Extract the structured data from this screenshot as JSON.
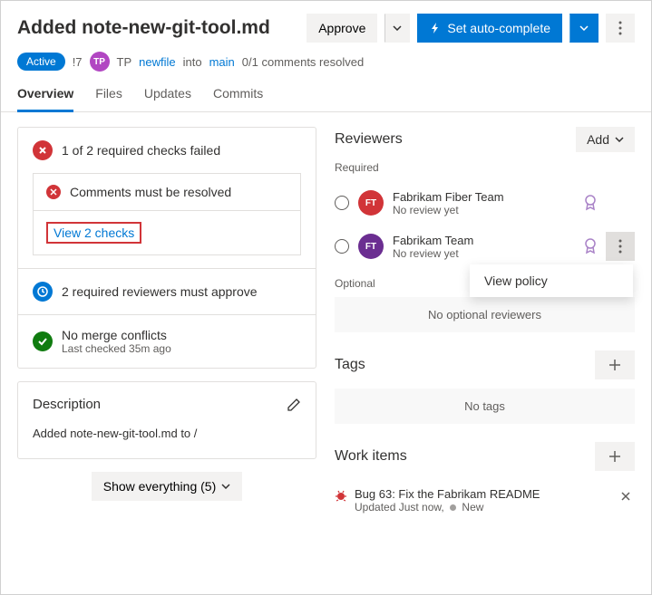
{
  "header": {
    "title": "Added note-new-git-tool.md",
    "approve": "Approve",
    "autocomplete": "Set auto-complete"
  },
  "meta": {
    "status": "Active",
    "pr_id": "!7",
    "avatar_initials": "TP",
    "author": "TP",
    "source_branch": "newfile",
    "into": "into",
    "target_branch": "main",
    "comments": "0/1 comments resolved"
  },
  "tabs": {
    "overview": "Overview",
    "files": "Files",
    "updates": "Updates",
    "commits": "Commits"
  },
  "checks": {
    "failed_title": "1 of 2 required checks failed",
    "comments_resolved": "Comments must be resolved",
    "view_link": "View 2 checks",
    "reviewers_approve": "2 required reviewers must approve",
    "no_conflicts": "No merge conflicts",
    "last_checked": "Last checked 35m ago"
  },
  "description": {
    "title": "Description",
    "body": "Added note-new-git-tool.md to /"
  },
  "show_everything": "Show everything (5)",
  "reviewers": {
    "title": "Reviewers",
    "add": "Add",
    "required": "Required",
    "optional": "Optional",
    "no_optional": "No optional reviewers",
    "items": [
      {
        "initials": "FT",
        "name": "Fabrikam Fiber Team",
        "status": "No review yet"
      },
      {
        "initials": "FT",
        "name": "Fabrikam Team",
        "status": "No review yet"
      }
    ]
  },
  "popup": {
    "view_policy": "View policy"
  },
  "tags": {
    "title": "Tags",
    "none": "No tags"
  },
  "work_items": {
    "title": "Work items",
    "items": [
      {
        "title": "Bug 63: Fix the Fabrikam README",
        "updated": "Updated Just now,",
        "state": "New"
      }
    ]
  }
}
